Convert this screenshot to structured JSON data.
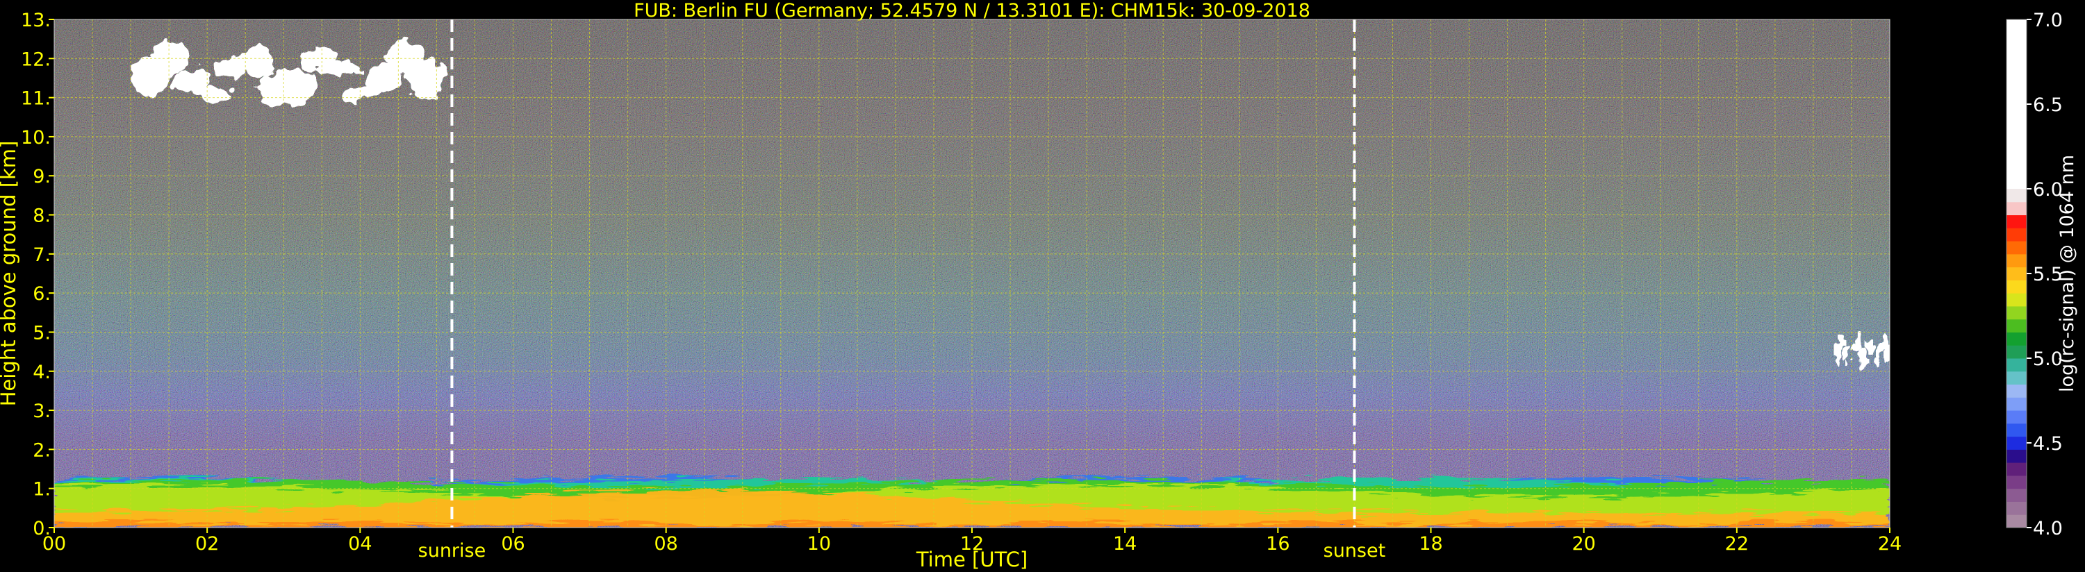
{
  "chart_data": {
    "type": "heatmap",
    "title": "FUB: Berlin FU (Germany; 52.4579 N / 13.3101 E):    CHM15k: 30-09-2018",
    "xlabel": "Time [UTC]",
    "ylabel": "Height above ground [km]",
    "xlim": [
      0,
      24
    ],
    "ylim": [
      0,
      13
    ],
    "x_ticks": [
      "00",
      "02",
      "04",
      "06",
      "08",
      "10",
      "12",
      "14",
      "16",
      "18",
      "20",
      "22",
      "24"
    ],
    "y_ticks": [
      "0.",
      "1.",
      "2.",
      "3.",
      "4.",
      "5.",
      "6.",
      "7.",
      "8.",
      "9.",
      "10.",
      "11.",
      "12.",
      "13."
    ],
    "grid": true,
    "markers": [
      {
        "label": "sunrise",
        "time": 5.2
      },
      {
        "label": "sunset",
        "time": 17.0
      }
    ],
    "colorbar": {
      "label": "log(rc-signal) @ 1064 nm",
      "range": [
        4.0,
        7.0
      ],
      "ticks": [
        "4.0",
        "4.5",
        "5.0",
        "5.5",
        "6.0",
        "6.5",
        "7.0"
      ],
      "colors": [
        "#a98aa3",
        "#9a739a",
        "#8c5b92",
        "#7a3d87",
        "#60207a",
        "#2a0d8c",
        "#1d2ce0",
        "#3058f0",
        "#5a7cf7",
        "#7e9ef7",
        "#9cb8f4",
        "#65c2c8",
        "#35b39c",
        "#1f9e57",
        "#13a02f",
        "#4cbd20",
        "#92d51f",
        "#d8e51c",
        "#fcd91c",
        "#ffbd1a",
        "#ff9a0f",
        "#ff6a05",
        "#ff3c06",
        "#ff1510",
        "#f8c6c6",
        "#f0e8e8"
      ],
      "colors_above": "#ffffff"
    },
    "layers": [
      {
        "name": "boundary-layer",
        "height_km": [
          0.0,
          1.3
        ]
      },
      {
        "name": "cloud",
        "time_h": [
          1.1,
          5.0
        ],
        "height_km": [
          10.6,
          12.5
        ]
      },
      {
        "name": "cloud",
        "time_h": [
          23.3,
          24.0
        ],
        "height_km": [
          4.0,
          5.0
        ]
      }
    ]
  }
}
